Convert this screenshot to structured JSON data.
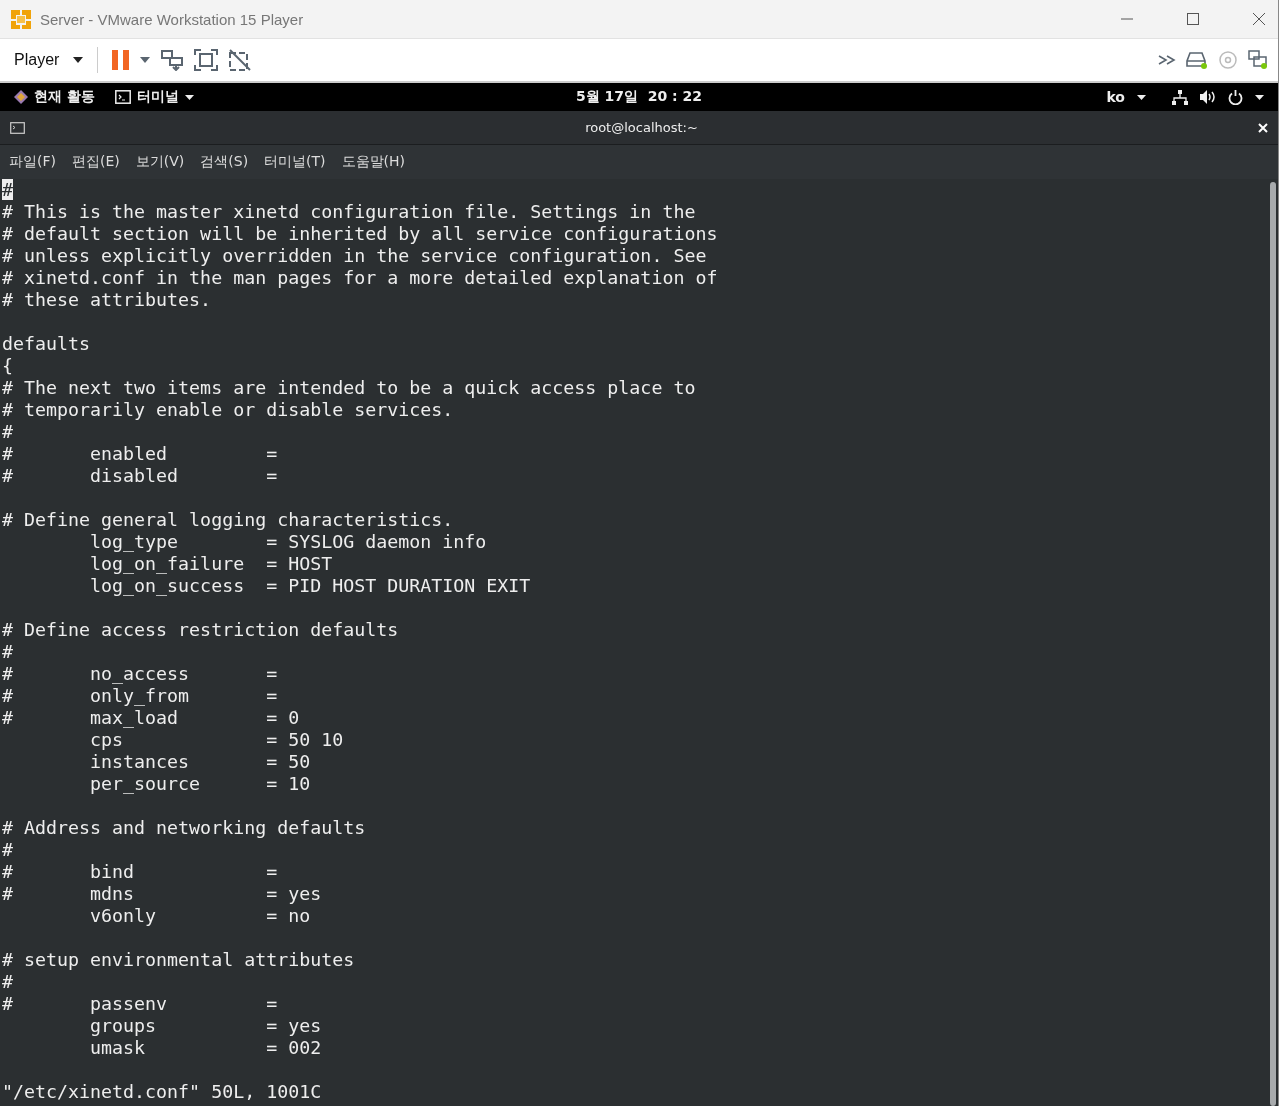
{
  "window": {
    "title": "Server - VMware Workstation 15 Player"
  },
  "toolbar": {
    "player_menu": "Player"
  },
  "top_bar": {
    "activities": "현재 활동",
    "app_menu": "터미널",
    "clock": "5월 17일  20 : 22",
    "input_method": "ko"
  },
  "terminal": {
    "title": "root@localhost:~",
    "menu": [
      "파일(F)",
      "편집(E)",
      "보기(V)",
      "검색(S)",
      "터미널(T)",
      "도움말(H)"
    ],
    "lines": [
      {
        "kind": "text",
        "text": "#",
        "cursor": true
      },
      {
        "kind": "text",
        "text": "# This is the master xinetd configuration file. Settings in the",
        "cursor": false
      },
      {
        "kind": "text",
        "text": "# default section will be inherited by all service configurations",
        "cursor": false
      },
      {
        "kind": "text",
        "text": "# unless explicitly overridden in the service configuration. See",
        "cursor": false
      },
      {
        "kind": "text",
        "text": "# xinetd.conf in the man pages for a more detailed explanation of",
        "cursor": false
      },
      {
        "kind": "text",
        "text": "# these attributes.",
        "cursor": false
      },
      {
        "kind": "blank"
      },
      {
        "kind": "text",
        "text": "defaults",
        "cursor": false
      },
      {
        "kind": "text",
        "text": "{",
        "cursor": false
      },
      {
        "kind": "text",
        "text": "# The next two items are intended to be a quick access place to",
        "cursor": false
      },
      {
        "kind": "text",
        "text": "# temporarily enable or disable services.",
        "cursor": false
      },
      {
        "kind": "text",
        "text": "#",
        "cursor": false
      },
      {
        "kind": "text",
        "text": "#       enabled         =",
        "cursor": false
      },
      {
        "kind": "text",
        "text": "#       disabled        =",
        "cursor": false
      },
      {
        "kind": "blank"
      },
      {
        "kind": "text",
        "text": "# Define general logging characteristics.",
        "cursor": false
      },
      {
        "kind": "text",
        "text": "        log_type        = SYSLOG daemon info",
        "cursor": false
      },
      {
        "kind": "text",
        "text": "        log_on_failure  = HOST",
        "cursor": false
      },
      {
        "kind": "text",
        "text": "        log_on_success  = PID HOST DURATION EXIT",
        "cursor": false
      },
      {
        "kind": "blank"
      },
      {
        "kind": "text",
        "text": "# Define access restriction defaults",
        "cursor": false
      },
      {
        "kind": "text",
        "text": "#",
        "cursor": false
      },
      {
        "kind": "text",
        "text": "#       no_access       =",
        "cursor": false
      },
      {
        "kind": "text",
        "text": "#       only_from       =",
        "cursor": false
      },
      {
        "kind": "text",
        "text": "#       max_load        = 0",
        "cursor": false
      },
      {
        "kind": "text",
        "text": "        cps             = 50 10",
        "cursor": false
      },
      {
        "kind": "text",
        "text": "        instances       = 50",
        "cursor": false
      },
      {
        "kind": "text",
        "text": "        per_source      = 10",
        "cursor": false
      },
      {
        "kind": "blank"
      },
      {
        "kind": "text",
        "text": "# Address and networking defaults",
        "cursor": false
      },
      {
        "kind": "text",
        "text": "#",
        "cursor": false
      },
      {
        "kind": "text",
        "text": "#       bind            =",
        "cursor": false
      },
      {
        "kind": "text",
        "text": "#       mdns            = yes",
        "cursor": false
      },
      {
        "kind": "text",
        "text": "        v6only          = no",
        "cursor": false
      },
      {
        "kind": "blank"
      },
      {
        "kind": "text",
        "text": "# setup environmental attributes",
        "cursor": false
      },
      {
        "kind": "text",
        "text": "#",
        "cursor": false
      },
      {
        "kind": "text",
        "text": "#       passenv         =",
        "cursor": false
      },
      {
        "kind": "text",
        "text": "        groups          = yes",
        "cursor": false
      },
      {
        "kind": "text",
        "text": "        umask           = 002",
        "cursor": false
      },
      {
        "kind": "blank"
      },
      {
        "kind": "text",
        "text": "\"/etc/xinetd.conf\" 50L, 1001C",
        "cursor": false
      }
    ]
  }
}
